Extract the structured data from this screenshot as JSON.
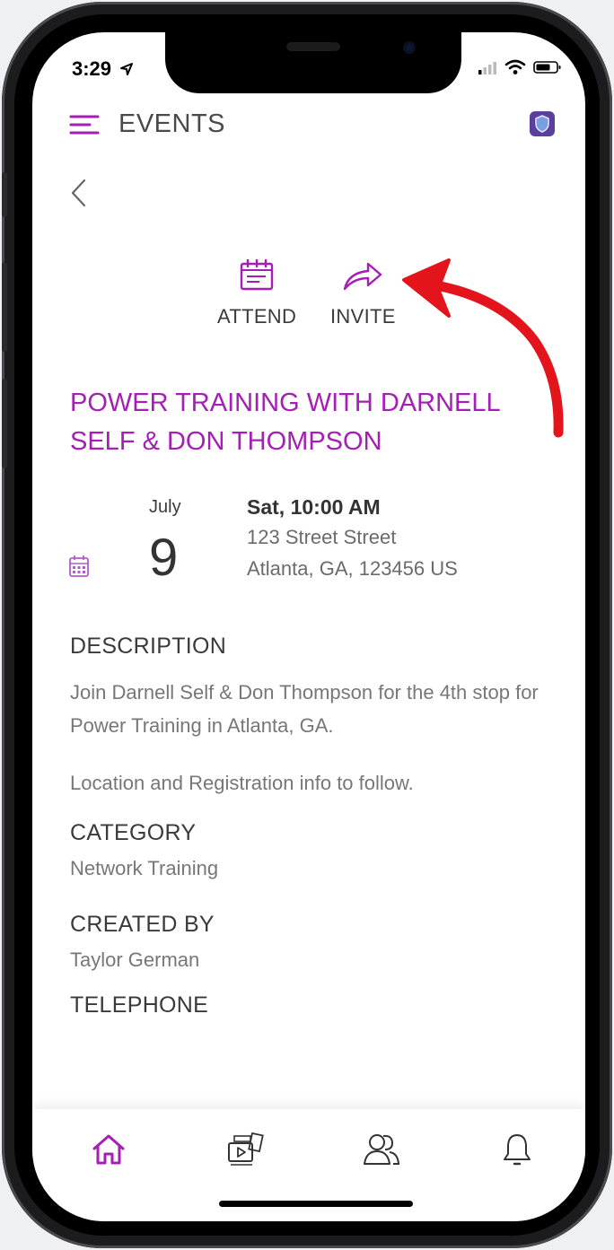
{
  "status": {
    "time": "3:29"
  },
  "header": {
    "title": "EVENTS"
  },
  "actions": {
    "attend_label": "ATTEND",
    "invite_label": "INVITE"
  },
  "event": {
    "title": "POWER TRAINING WITH DARNELL SELF & DON THOMPSON",
    "month": "July",
    "day": "9",
    "time": "Sat, 10:00 AM",
    "address_line1": "123 Street Street",
    "address_line2": "Atlanta,  GA, 123456 US"
  },
  "description": {
    "heading": "DESCRIPTION",
    "text1": "Join Darnell Self & Don Thompson for the 4th stop for Power Training in Atlanta, GA.",
    "text2": "Location and Registration info to follow."
  },
  "category": {
    "heading": "CATEGORY",
    "value": "Network Training"
  },
  "created_by": {
    "heading": "CREATED BY",
    "value": "Taylor German"
  },
  "telephone": {
    "heading": "TELEPHONE"
  },
  "tabs": [
    "home-icon",
    "media-icon",
    "people-icon",
    "bell-icon"
  ],
  "colors": {
    "accent": "#a41fb3",
    "annotation_arrow": "#e3141b"
  }
}
